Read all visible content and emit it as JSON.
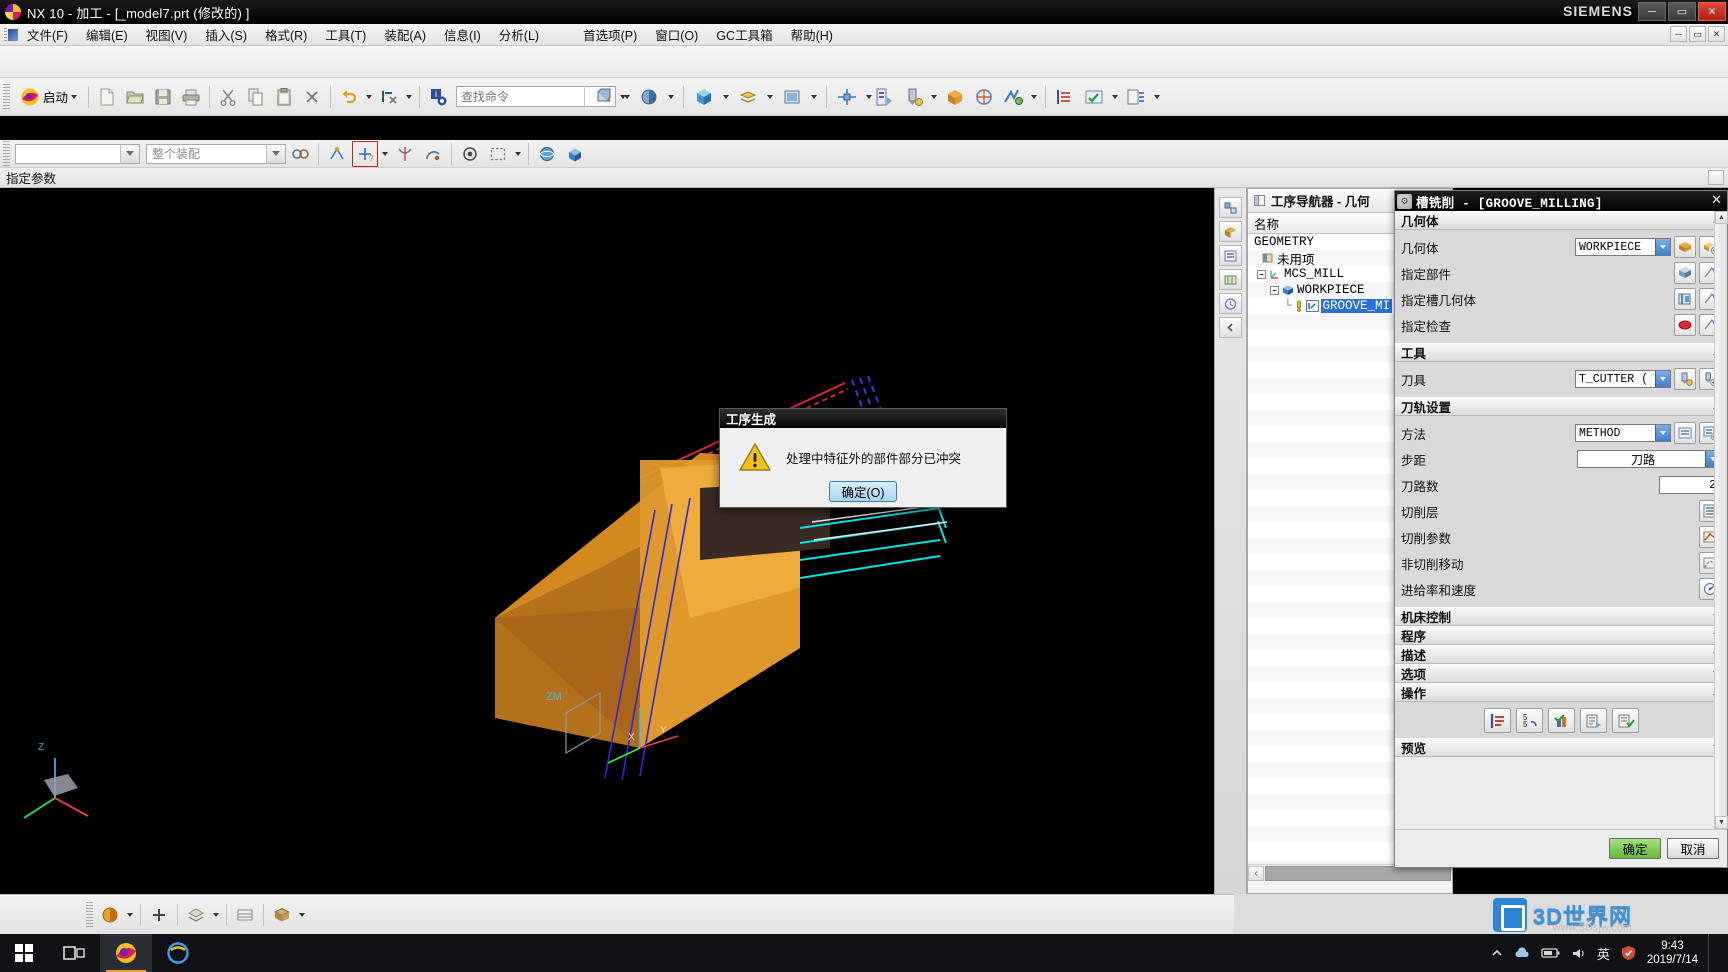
{
  "titlebar": {
    "text": "NX 10 - 加工 - [_model7.prt  (修改的)  ]",
    "brand": "SIEMENS",
    "minimize": "─",
    "maximize": "▭",
    "close": "✕",
    "app_icon": "nx-logo-icon"
  },
  "menubar": {
    "items": [
      {
        "label": "文件(F)",
        "name": "menu-file"
      },
      {
        "label": "编辑(E)",
        "name": "menu-edit"
      },
      {
        "label": "视图(V)",
        "name": "menu-view"
      },
      {
        "label": "插入(S)",
        "name": "menu-insert"
      },
      {
        "label": "格式(R)",
        "name": "menu-format"
      },
      {
        "label": "工具(T)",
        "name": "menu-tools"
      },
      {
        "label": "装配(A)",
        "name": "menu-assemblies"
      },
      {
        "label": "信息(I)",
        "name": "menu-information"
      },
      {
        "label": "分析(L)",
        "name": "menu-analysis"
      },
      {
        "label": "首选项(P)",
        "name": "menu-preferences"
      },
      {
        "label": "窗口(O)",
        "name": "menu-window"
      },
      {
        "label": "GC工具箱",
        "name": "menu-gc-toolbox"
      },
      {
        "label": "帮助(H)",
        "name": "menu-help"
      }
    ],
    "right_buttons": [
      "─",
      "▭",
      "✕"
    ]
  },
  "toolbar": {
    "start_label": "启动",
    "find_placeholder": "查找命令",
    "find_value": "",
    "buttons": [
      {
        "name": "new-file-button",
        "glyph": "📄"
      },
      {
        "name": "open-file-button",
        "glyph": "📂"
      },
      {
        "name": "save-button",
        "glyph": "💾"
      },
      {
        "name": "print-button",
        "glyph": "🖨"
      },
      {
        "name": "cut-button",
        "glyph": "✂"
      },
      {
        "name": "copy-button",
        "glyph": "⧉"
      },
      {
        "name": "paste-button",
        "glyph": "📋"
      },
      {
        "name": "delete-button",
        "glyph": "✕"
      },
      {
        "name": "undo-button",
        "glyph": "↶"
      },
      {
        "name": "redo-button",
        "glyph": "↷"
      },
      {
        "name": "info-button",
        "glyph": "ℹ"
      }
    ]
  },
  "selection_bar": {
    "type_filter_value": "",
    "scope_value": "整个装配",
    "status_text": "指定参数"
  },
  "navigator": {
    "title": "工序导航器 - 几何",
    "column_header": "名称",
    "tree": [
      {
        "label": "GEOMETRY",
        "depth": 0,
        "icon": "",
        "selected": false
      },
      {
        "label": "未用项",
        "depth": 1,
        "icon": "unused-icon",
        "selected": false
      },
      {
        "label": "MCS_MILL",
        "depth": 1,
        "icon": "mcs-icon",
        "selected": false
      },
      {
        "label": "WORKPIECE",
        "depth": 2,
        "icon": "workpiece-icon",
        "selected": false
      },
      {
        "label": "GROOVE_MI",
        "depth": 3,
        "icon": "operation-icon",
        "selected": true
      }
    ]
  },
  "dialog": {
    "title": "槽铣削 - [GROOVE_MILLING]",
    "close_glyph": "✕",
    "sections": [
      {
        "name": "geometry",
        "title": "几何体",
        "expanded": true,
        "rows": [
          {
            "label": "几何体",
            "type": "combo",
            "value": "WORKPIECE",
            "buttons": [
              "edit-geometry-icon",
              "new-geometry-icon"
            ]
          },
          {
            "label": "指定部件",
            "type": "buttons",
            "buttons": [
              "select-part-icon",
              "display-part-icon"
            ]
          },
          {
            "label": "指定槽几何体",
            "type": "buttons",
            "buttons": [
              "select-groove-icon",
              "display-groove-icon"
            ]
          },
          {
            "label": "指定检查",
            "type": "buttons",
            "buttons": [
              "select-check-icon",
              "display-check-icon"
            ]
          }
        ]
      },
      {
        "name": "tool",
        "title": "工具",
        "expanded": true,
        "rows": [
          {
            "label": "刀具",
            "type": "combo",
            "value": "T_CUTTER (",
            "buttons": [
              "edit-tool-icon",
              "new-tool-icon"
            ]
          }
        ]
      },
      {
        "name": "toolpath-settings",
        "title": "刀轨设置",
        "expanded": true,
        "rows": [
          {
            "label": "方法",
            "type": "combo",
            "value": "METHOD",
            "buttons": [
              "edit-method-icon",
              "new-method-icon"
            ]
          },
          {
            "label": "步距",
            "type": "combo-wide",
            "value": "刀路",
            "buttons": []
          },
          {
            "label": "刀路数",
            "type": "number",
            "value": "2",
            "buttons": []
          },
          {
            "label": "切削层",
            "type": "buttons",
            "buttons": [
              "cut-levels-icon"
            ]
          },
          {
            "label": "切削参数",
            "type": "buttons",
            "buttons": [
              "cutting-parameters-icon"
            ]
          },
          {
            "label": "非切削移动",
            "type": "buttons",
            "buttons": [
              "non-cutting-moves-icon"
            ]
          },
          {
            "label": "进给率和速度",
            "type": "buttons",
            "buttons": [
              "feeds-speeds-icon"
            ]
          }
        ]
      },
      {
        "name": "machine-control",
        "title": "机床控制",
        "expanded": false,
        "rows": []
      },
      {
        "name": "program",
        "title": "程序",
        "expanded": false,
        "rows": []
      },
      {
        "name": "description",
        "title": "描述",
        "expanded": false,
        "rows": []
      },
      {
        "name": "options",
        "title": "选项",
        "expanded": false,
        "rows": []
      },
      {
        "name": "actions",
        "title": "操作",
        "expanded": true,
        "operation_buttons": [
          "generate-icon",
          "replay-icon",
          "verify-icon",
          "list-icon",
          "confirm-icon"
        ]
      },
      {
        "name": "preview",
        "title": "预览",
        "expanded": false,
        "rows": []
      }
    ],
    "footer": {
      "ok": "确定",
      "cancel": "取消"
    }
  },
  "modal": {
    "title": "工序生成",
    "message": "处理中特征外的部件部分已冲突",
    "ok_label": "确定(O)",
    "icon": "warning-icon"
  },
  "bottom_toolbar": {
    "buttons": [
      {
        "name": "render-style-button",
        "glyph": "◕"
      },
      {
        "name": "add-view-button",
        "glyph": "＋"
      },
      {
        "name": "shading-button",
        "glyph": "◈"
      },
      {
        "name": "layer-button",
        "glyph": "▤"
      },
      {
        "name": "view-section-button",
        "glyph": "▦"
      }
    ]
  },
  "taskbar": {
    "start": "start-icon",
    "items": [
      {
        "name": "taskview-icon"
      },
      {
        "name": "nx-taskbar-icon",
        "active": true
      },
      {
        "name": "browser-taskbar-icon"
      }
    ],
    "tray": [
      "chevron-up-icon",
      "cloud-icon",
      "battery-icon",
      "volume-icon",
      "ime-icon",
      "security-icon"
    ],
    "ime_label": "英",
    "clock_time": "9:43",
    "clock_date": "2019/7/14"
  },
  "watermark": {
    "text": "3D世界网",
    "url": "www.3Dsjw.com"
  },
  "viewport": {
    "bg_color": "#000000",
    "wcs_label": "ZM",
    "axis_labels": {
      "x": "XC",
      "y": "YC",
      "z": "ZC"
    }
  },
  "colors": {
    "accent": "#2a6fd6",
    "part_orange": "#d8861a",
    "part_light": "#f0a93c",
    "toolpath_cyan": "#00e8e8",
    "toolpath_red": "#e02020",
    "toolpath_blue": "#2020e0",
    "ok_green": "#63b83c"
  }
}
